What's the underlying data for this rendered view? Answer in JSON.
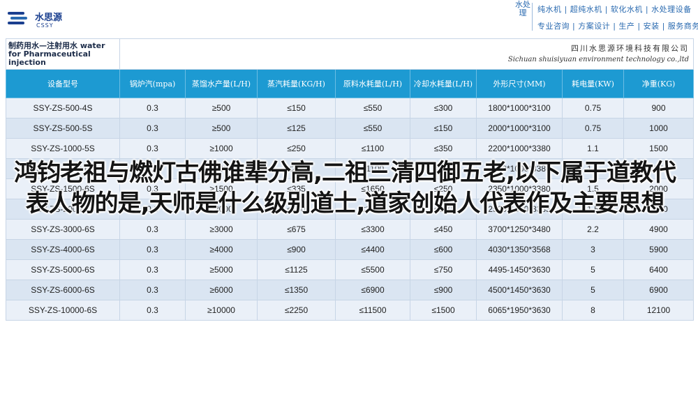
{
  "header": {
    "logo": {
      "cn": "水思源",
      "en": "CSSY"
    },
    "slogan_vertical": "水处理",
    "slogan_line_1": "纯水机 | 超纯水机 | 软化水机 | 水处理设备",
    "slogan_line_2": "专业咨询 | 方案设计 | 生产 | 安装 | 服务商务"
  },
  "table": {
    "title": "制药用水—注射用水 water for Pharmaceutical injection",
    "company_cn": "四川水思源环境科技有限公司",
    "company_en": "Sichuan shuisiyuan environment technology co.,ltd",
    "columns": [
      "设备型号",
      "锅炉汽(mpa)",
      "蒸馏水产量(L/H)",
      "蒸汽耗量(KG/H)",
      "原料水耗量(L/H)",
      "冷却水耗量(L/H)",
      "外形尺寸(MM)",
      "耗电量(KW)",
      "净重(KG)"
    ],
    "rows": [
      [
        "SSY-ZS-500-4S",
        "0.3",
        "≥500",
        "≤150",
        "≤550",
        "≤300",
        "1800*1000*3100",
        "0.75",
        "900"
      ],
      [
        "SSY-ZS-500-5S",
        "0.3",
        "≥500",
        "≤125",
        "≤550",
        "≤150",
        "2000*1000*3100",
        "0.75",
        "1000"
      ],
      [
        "SSY-ZS-1000-5S",
        "0.3",
        "≥1000",
        "≤250",
        "≤1100",
        "≤350",
        "2200*1000*3380",
        "1.1",
        "1500"
      ],
      [
        "SSY-ZS-1000-6S",
        "0.3",
        "≥1000",
        "≤225",
        "≤1100",
        "≤150",
        "2300*1000*3380",
        "1.1",
        "1550"
      ],
      [
        "SSY-ZS-1500-6S",
        "0.3",
        "≥1500",
        "≤335",
        "≤1650",
        "≤250",
        "2350*1000*3380",
        "1.5",
        "2000"
      ],
      [
        "SSY-ZS-2000-6S",
        "0.3",
        "≥2000",
        "≤450",
        "≤2200",
        "≤300",
        "2500*1000*3385",
        "1.5",
        "2950"
      ],
      [
        "SSY-ZS-3000-6S",
        "0.3",
        "≥3000",
        "≤675",
        "≤3300",
        "≤450",
        "3700*1250*3480",
        "2.2",
        "4900"
      ],
      [
        "SSY-ZS-4000-6S",
        "0.3",
        "≥4000",
        "≤900",
        "≤4400",
        "≤600",
        "4030*1350*3568",
        "3",
        "5900"
      ],
      [
        "SSY-ZS-5000-6S",
        "0.3",
        "≥5000",
        "≤1125",
        "≤5500",
        "≤750",
        "4495-1450*3630",
        "5",
        "6400"
      ],
      [
        "SSY-ZS-6000-6S",
        "0.3",
        "≥6000",
        "≤1350",
        "≤6900",
        "≤900",
        "4500*1450*3630",
        "5",
        "6900"
      ],
      [
        "SSY-ZS-10000-6S",
        "0.3",
        "≥10000",
        "≤2250",
        "≤11500",
        "≤1500",
        "6065*1950*3630",
        "8",
        "12100"
      ]
    ]
  },
  "overlay": {
    "text": "鸿钧老祖与燃灯古佛谁辈分高,二祖三清四御五老,以下属于道教代表人物的是,天师是什么级别道士,道家创始人代表作及主要思想"
  },
  "colors": {
    "header_fill": "#1d9ad2",
    "row_odd": "#eaf0f8",
    "row_even": "#dae5f2",
    "brand": "#1a3f8f"
  }
}
